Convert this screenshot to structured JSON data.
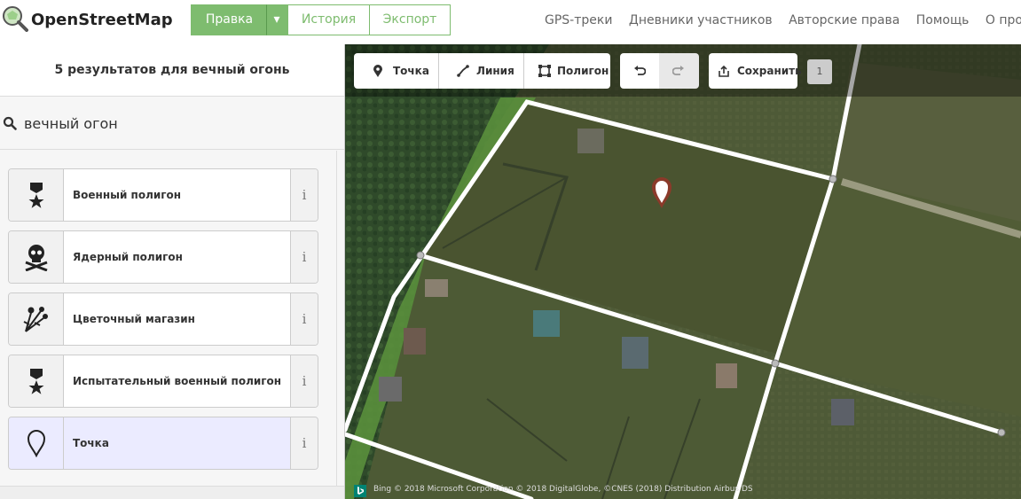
{
  "app": {
    "brand": "OpenStreetMap",
    "logo_icon": "magnifier-map-icon"
  },
  "nav": {
    "edit": "Правка",
    "history": "История",
    "export": "Экспорт",
    "right_links": [
      "GPS-треки",
      "Дневники участников",
      "Авторские права",
      "Помощь",
      "О проек"
    ]
  },
  "sidebar": {
    "header": "5 результатов для вечный огонь",
    "search_value": "вечный огон",
    "results": [
      {
        "label": "Военный полигон",
        "icon": "military-medal-icon",
        "info": "i"
      },
      {
        "label": "Ядерный полигон",
        "icon": "skull-crossbones-icon",
        "info": "i"
      },
      {
        "label": "Цветочный магазин",
        "icon": "flowers-icon",
        "info": "i"
      },
      {
        "label": "Испытательный военный полигон",
        "icon": "military-medal-icon",
        "info": "i"
      },
      {
        "label": "Точка",
        "icon": "map-pin-icon",
        "info": "i"
      }
    ]
  },
  "toolbar": {
    "point": "Точка",
    "line": "Линия",
    "area": "Полигон",
    "save": "Сохранить",
    "save_count": "1"
  },
  "map": {
    "attribution": "Bing  © 2018 Microsoft Corporation © 2018 DigitalGlobe, ©CNES (2018) Distribution Airbus DS"
  },
  "colors": {
    "accent": "#7ebc6f",
    "selected_row": "#ebebff",
    "pin": "#8b3a2a"
  }
}
